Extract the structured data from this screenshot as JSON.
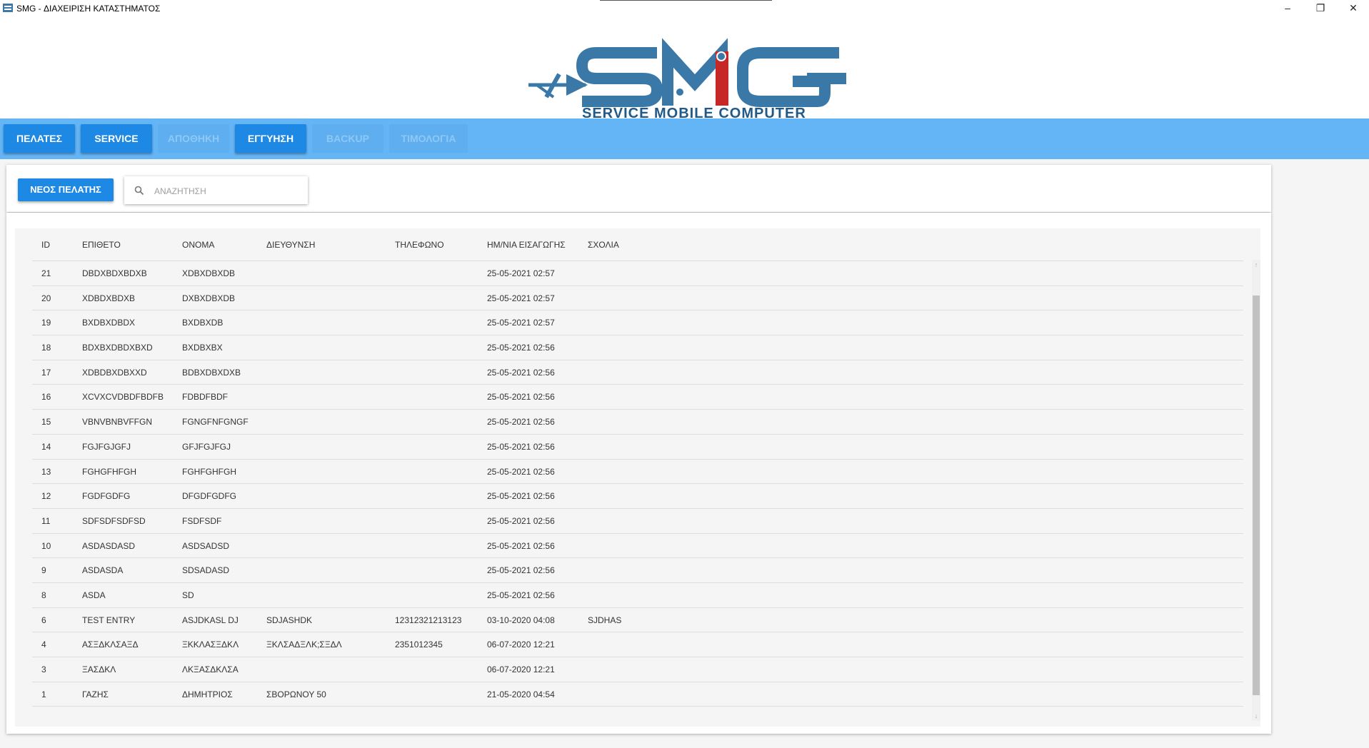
{
  "window": {
    "title": "SMG - ΔΙΑΧΕΙΡΙΣΗ ΚΑΤΑΣΤΗΜΑΤΟΣ",
    "minimize": "–",
    "maximize": "❐",
    "close": "✕"
  },
  "logo": {
    "text": "SMG",
    "tagline": "SERVICE MOBILE COMPUTER",
    "colors": {
      "primary": "#3a78a8",
      "accent": "#c62828"
    }
  },
  "nav": {
    "items": [
      {
        "label": "ΠΕΛΑΤΕΣ",
        "state": "active"
      },
      {
        "label": "SERVICE",
        "state": "active"
      },
      {
        "label": "ΑΠΟΘΗΚΗ",
        "state": "disabled"
      },
      {
        "label": "ΕΓΓΥΗΣΗ",
        "state": "active"
      },
      {
        "label": "BACKUP",
        "state": "disabled"
      },
      {
        "label": "ΤΙΜΟΛΟΓΙΑ",
        "state": "disabled"
      }
    ]
  },
  "toolbar": {
    "new_customer_label": "ΝΕΟΣ ΠΕΛΑΤΗΣ",
    "search_placeholder": "ΑΝΑΖΗΤΗΣΗ"
  },
  "table": {
    "columns": {
      "id": "ID",
      "surname": "ΕΠΙΘΕΤΟ",
      "name": "ΟΝΟΜΑ",
      "address": "ΔΙΕΥΘΥΝΣΗ",
      "phone": "ΤΗΛΕΦΩΝΟ",
      "date": "ΗΜ/ΝΙΑ ΕΙΣΑΓΩΓΗΣ",
      "comments": "ΣΧΟΛΙΑ"
    },
    "rows": [
      {
        "id": "21",
        "surname": "DBDXBDXBDXB",
        "name": "XDBXDBXDB",
        "address": "",
        "phone": "",
        "date": "25-05-2021 02:57",
        "comments": ""
      },
      {
        "id": "20",
        "surname": "XDBDXBDXB",
        "name": "DXBXDBXDB",
        "address": "",
        "phone": "",
        "date": "25-05-2021 02:57",
        "comments": ""
      },
      {
        "id": "19",
        "surname": "BXDBXDBDX",
        "name": "BXDBXDB",
        "address": "",
        "phone": "",
        "date": "25-05-2021 02:57",
        "comments": ""
      },
      {
        "id": "18",
        "surname": "BDXBXDBDXBXD",
        "name": "BXDBXBX",
        "address": "",
        "phone": "",
        "date": "25-05-2021 02:56",
        "comments": ""
      },
      {
        "id": "17",
        "surname": "XDBDBXDBXXD",
        "name": "BDBXDBXDXB",
        "address": "",
        "phone": "",
        "date": "25-05-2021 02:56",
        "comments": ""
      },
      {
        "id": "16",
        "surname": "XCVXCVDBDFBDFB",
        "name": "FDBDFBDF",
        "address": "",
        "phone": "",
        "date": "25-05-2021 02:56",
        "comments": ""
      },
      {
        "id": "15",
        "surname": "VBNVBNBVFFGN",
        "name": "FGNGFNFGNGF",
        "address": "",
        "phone": "",
        "date": "25-05-2021 02:56",
        "comments": ""
      },
      {
        "id": "14",
        "surname": "FGJFGJGFJ",
        "name": "GFJFGJFGJ",
        "address": "",
        "phone": "",
        "date": "25-05-2021 02:56",
        "comments": ""
      },
      {
        "id": "13",
        "surname": "FGHGFHFGH",
        "name": "FGHFGHFGH",
        "address": "",
        "phone": "",
        "date": "25-05-2021 02:56",
        "comments": ""
      },
      {
        "id": "12",
        "surname": "FGDFGDFG",
        "name": "DFGDFGDFG",
        "address": "",
        "phone": "",
        "date": "25-05-2021 02:56",
        "comments": ""
      },
      {
        "id": "11",
        "surname": "SDFSDFSDFSD",
        "name": "FSDFSDF",
        "address": "",
        "phone": "",
        "date": "25-05-2021 02:56",
        "comments": ""
      },
      {
        "id": "10",
        "surname": "ASDASDASD",
        "name": "ASDSADSD",
        "address": "",
        "phone": "",
        "date": "25-05-2021 02:56",
        "comments": ""
      },
      {
        "id": "9",
        "surname": "ASDASDA",
        "name": "SDSADASD",
        "address": "",
        "phone": "",
        "date": "25-05-2021 02:56",
        "comments": ""
      },
      {
        "id": "8",
        "surname": "ASDA",
        "name": "SD",
        "address": "",
        "phone": "",
        "date": "25-05-2021 02:56",
        "comments": ""
      },
      {
        "id": "6",
        "surname": "TEST ENTRY",
        "name": "ASJDKASL DJ",
        "address": "SDJASHDK",
        "phone": "12312321213123",
        "date": "03-10-2020 04:08",
        "comments": "SJDHAS"
      },
      {
        "id": "4",
        "surname": "ΑΣΞΔΚΛΣΑΞΔ",
        "name": "ΞΚΚΛΑΣΞΔΚΛ",
        "address": "ΞΚΛΣΑΔΞΛΚ;ΣΞΔΛ",
        "phone": "2351012345",
        "date": "06-07-2020 12:21",
        "comments": ""
      },
      {
        "id": "3",
        "surname": "ΞΑΣΔΚΛ",
        "name": "ΛΚΞΑΣΔΚΛΣΑ",
        "address": "",
        "phone": "",
        "date": "06-07-2020 12:21",
        "comments": ""
      },
      {
        "id": "1",
        "surname": "ΓΑΖΗΣ",
        "name": "ΔΗΜΗΤΡΙΟΣ",
        "address": "ΣΒΟΡΩΝΟΥ 50",
        "phone": "",
        "date": "21-05-2020 04:54",
        "comments": ""
      }
    ]
  },
  "scrollbar": {
    "up": "↑",
    "down": "↓"
  }
}
